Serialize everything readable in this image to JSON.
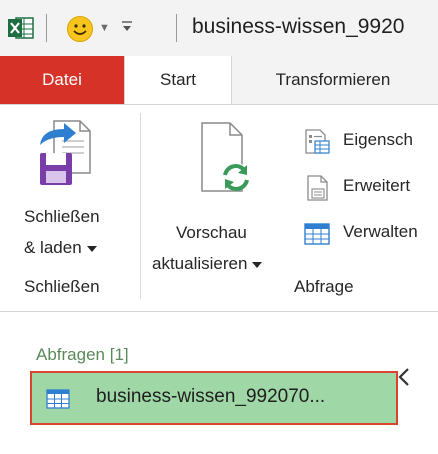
{
  "titlebar": {
    "document_title": "business-wissen_9920"
  },
  "tabs": [
    {
      "label": "Datei"
    },
    {
      "label": "Start"
    },
    {
      "label": "Transformieren"
    }
  ],
  "ribbon": {
    "close_load": {
      "line1": "Schließen",
      "line2": "& laden"
    },
    "refresh_preview": {
      "line1": "Vorschau",
      "line2": "aktualisieren"
    },
    "properties": {
      "label": "Eigensch"
    },
    "advanced_editor": {
      "label": "Erweitert"
    },
    "manage": {
      "label": "Verwalten"
    },
    "groups": {
      "close": "Schließen",
      "query": "Abfrage"
    }
  },
  "queries_pane": {
    "title": "Abfragen [1]",
    "items": [
      {
        "label": "business-wissen_992070..."
      }
    ]
  },
  "colors": {
    "file_tab": "#d63228",
    "selected_query_bg": "#a0d7a7",
    "selected_query_border": "#d8452f",
    "pane_title": "#5a8a5a"
  }
}
